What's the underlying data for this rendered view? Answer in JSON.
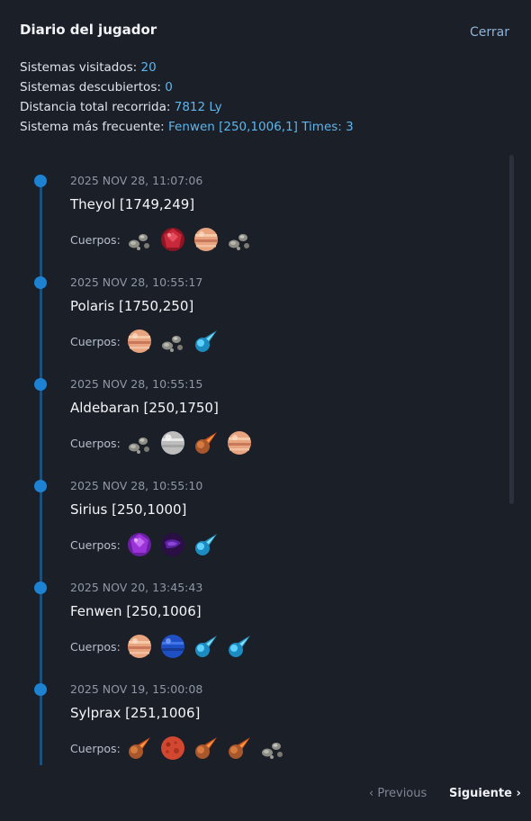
{
  "header": {
    "title": "Diario del jugador",
    "close_label": "Cerrar"
  },
  "stats": [
    {
      "label": "Sistemas visitados:",
      "value": "20"
    },
    {
      "label": "Sistemas descubiertos:",
      "value": "0"
    },
    {
      "label": "Distancia total recorrida:",
      "value": "7812 Ly"
    },
    {
      "label": "Sistema más frecuente:",
      "value": "Fenwen [250,1006,1] Times: 3"
    }
  ],
  "bodies_label": "Cuerpos:",
  "entries": [
    {
      "timestamp": "2025 NOV 28, 11:07:06",
      "system": "Theyol [1749,249]",
      "bodies": [
        "asteroid-icon",
        "red-gem-planet-icon",
        "gas-giant-icon",
        "asteroid-icon"
      ]
    },
    {
      "timestamp": "2025 NOV 28, 10:55:17",
      "system": "Polaris [1750,250]",
      "bodies": [
        "gas-giant-icon",
        "asteroid-icon",
        "blue-comet-icon"
      ]
    },
    {
      "timestamp": "2025 NOV 28, 10:55:15",
      "system": "Aldebaran [250,1750]",
      "bodies": [
        "asteroid-icon",
        "white-planet-icon",
        "orange-comet-icon",
        "gas-giant-icon"
      ]
    },
    {
      "timestamp": "2025 NOV 28, 10:55:10",
      "system": "Sirius [250,1000]",
      "bodies": [
        "purple-gem-planet-icon",
        "dark-purple-planet-icon",
        "blue-comet-icon"
      ]
    },
    {
      "timestamp": "2025 NOV 20, 13:45:43",
      "system": "Fenwen [250,1006]",
      "bodies": [
        "gas-giant-icon",
        "blue-planet-icon",
        "blue-comet-icon",
        "blue-comet-icon"
      ]
    },
    {
      "timestamp": "2025 NOV 19, 15:00:08",
      "system": "Sylprax [251,1006]",
      "bodies": [
        "orange-comet-icon",
        "red-planet-icon",
        "orange-comet-icon",
        "orange-comet-icon",
        "asteroid-icon"
      ]
    }
  ],
  "pagination": {
    "previous_label": "‹ Previous",
    "next_label": "Siguiente ›"
  },
  "colors": {
    "accent": "#5db6ee",
    "timeline": "#1c82d1",
    "background": "#1b1f28"
  }
}
